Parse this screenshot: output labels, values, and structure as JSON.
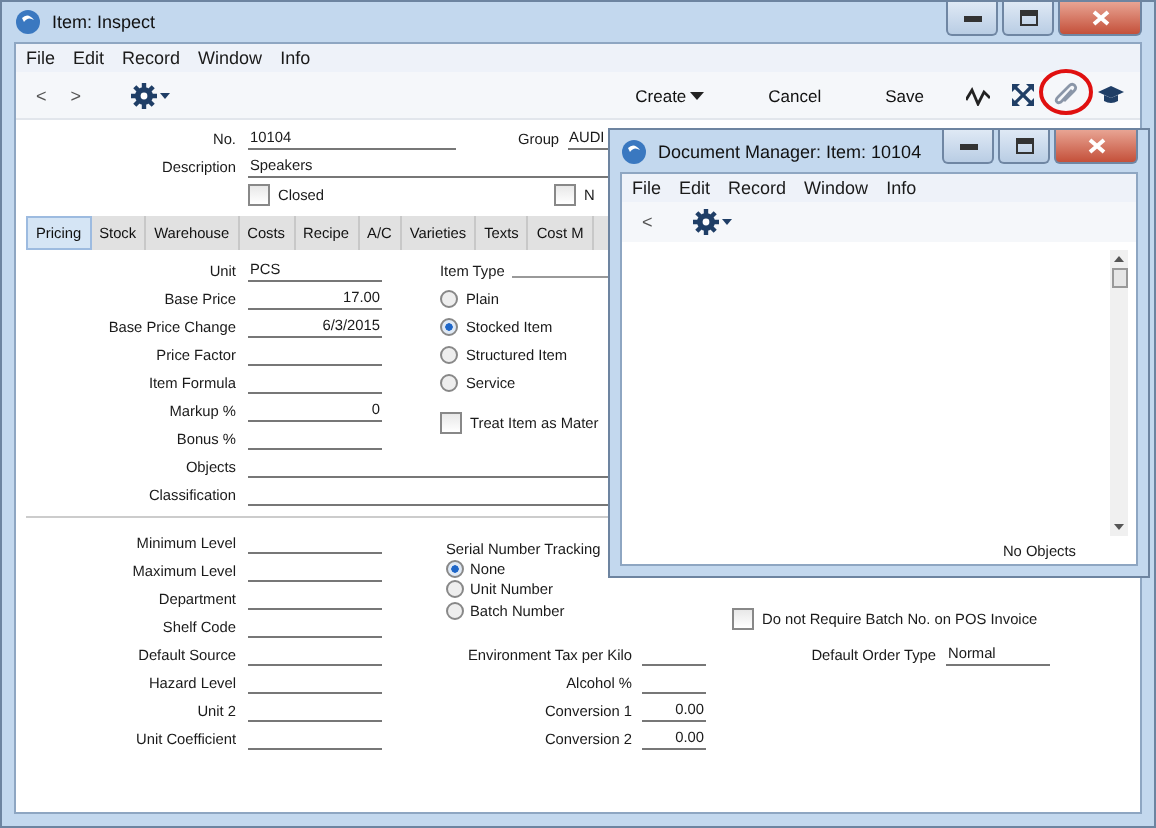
{
  "window": {
    "title": "Item: Inspect"
  },
  "menu": [
    "File",
    "Edit",
    "Record",
    "Window",
    "Info"
  ],
  "toolbar": {
    "back": "<",
    "forward": ">",
    "buttons": [
      {
        "label": "Create",
        "kind": "menu"
      },
      {
        "label": "Cancel",
        "kind": "plain"
      },
      {
        "label": "Save",
        "kind": "plain"
      }
    ],
    "icons": [
      {
        "kind": "chart",
        "highlighted": false
      },
      {
        "kind": "expand",
        "highlighted": false
      },
      {
        "kind": "attach",
        "highlighted": true
      },
      {
        "kind": "cap",
        "highlighted": false
      }
    ]
  },
  "header": {
    "fields": [
      {
        "label": "No.",
        "value": "10104"
      },
      {
        "label": "Description",
        "value": "Speakers"
      }
    ],
    "group": {
      "label": "Group",
      "value": "AUDI"
    },
    "checkboxes": [
      {
        "label": "Closed",
        "checked": false
      },
      {
        "label": "N",
        "checked": false
      }
    ]
  },
  "tabs": [
    {
      "label": "Pricing",
      "selected": true
    },
    {
      "label": "Stock",
      "selected": false
    },
    {
      "label": "Warehouse",
      "selected": false
    },
    {
      "label": "Costs",
      "selected": false
    },
    {
      "label": "Recipe",
      "selected": false
    },
    {
      "label": "A/C",
      "selected": false
    },
    {
      "label": "Varieties",
      "selected": false
    },
    {
      "label": "Texts",
      "selected": false
    },
    {
      "label": "Cost M",
      "selected": false
    }
  ],
  "pricing": {
    "fields": [
      {
        "label": "Unit",
        "value": "PCS",
        "kind": "text"
      },
      {
        "label": "Base Price",
        "value": "17.00",
        "kind": "number"
      },
      {
        "label": "Base Price Change",
        "value": "6/3/2015",
        "kind": "number"
      },
      {
        "label": "Price Factor",
        "kind": "text"
      },
      {
        "label": "Item Formula",
        "kind": "text"
      },
      {
        "label": "Markup %",
        "value": "0",
        "kind": "number"
      },
      {
        "label": "Bonus %",
        "kind": "text"
      }
    ],
    "wide_fields": [
      {
        "label": "Objects"
      },
      {
        "label": "Classification"
      }
    ],
    "item_type": {
      "label": "Item Type",
      "options": [
        {
          "label": "Plain",
          "selected": false
        },
        {
          "label": "Stocked Item",
          "selected": true
        },
        {
          "label": "Structured Item",
          "selected": false
        },
        {
          "label": "Service",
          "selected": false
        }
      ]
    },
    "material_checkbox": {
      "label": "Treat Item as Mater",
      "checked": false
    }
  },
  "stock": {
    "left_fields": [
      {
        "label": "Minimum Level"
      },
      {
        "label": "Maximum Level"
      },
      {
        "label": "Department"
      },
      {
        "label": "Shelf Code"
      },
      {
        "label": "Default Source"
      },
      {
        "label": "Hazard Level"
      },
      {
        "label": "Unit 2"
      },
      {
        "label": "Unit Coefficient"
      }
    ],
    "serial_tracking": {
      "label": "Serial Number Tracking",
      "options": [
        {
          "label": "None",
          "selected": true
        },
        {
          "label": "Unit Number",
          "selected": false
        },
        {
          "label": "Batch Number",
          "selected": false
        }
      ]
    },
    "batch_checkbox": {
      "label": "Do not Require Batch No. on POS Invoice",
      "checked": false
    },
    "mid_fields": [
      {
        "label": "Environment Tax per Kilo"
      },
      {
        "label": "Alcohol %"
      },
      {
        "label": "Conversion 1",
        "value": "0.00"
      },
      {
        "label": "Conversion 2",
        "value": "0.00"
      }
    ],
    "right_fields": [
      {
        "label": "Default Order Type",
        "value": "Normal"
      }
    ]
  },
  "doc_manager": {
    "title": "Document Manager: Item: 10104",
    "menu": [
      "File",
      "Edit",
      "Record",
      "Window",
      "Info"
    ],
    "back": "<",
    "status": "No Objects"
  }
}
